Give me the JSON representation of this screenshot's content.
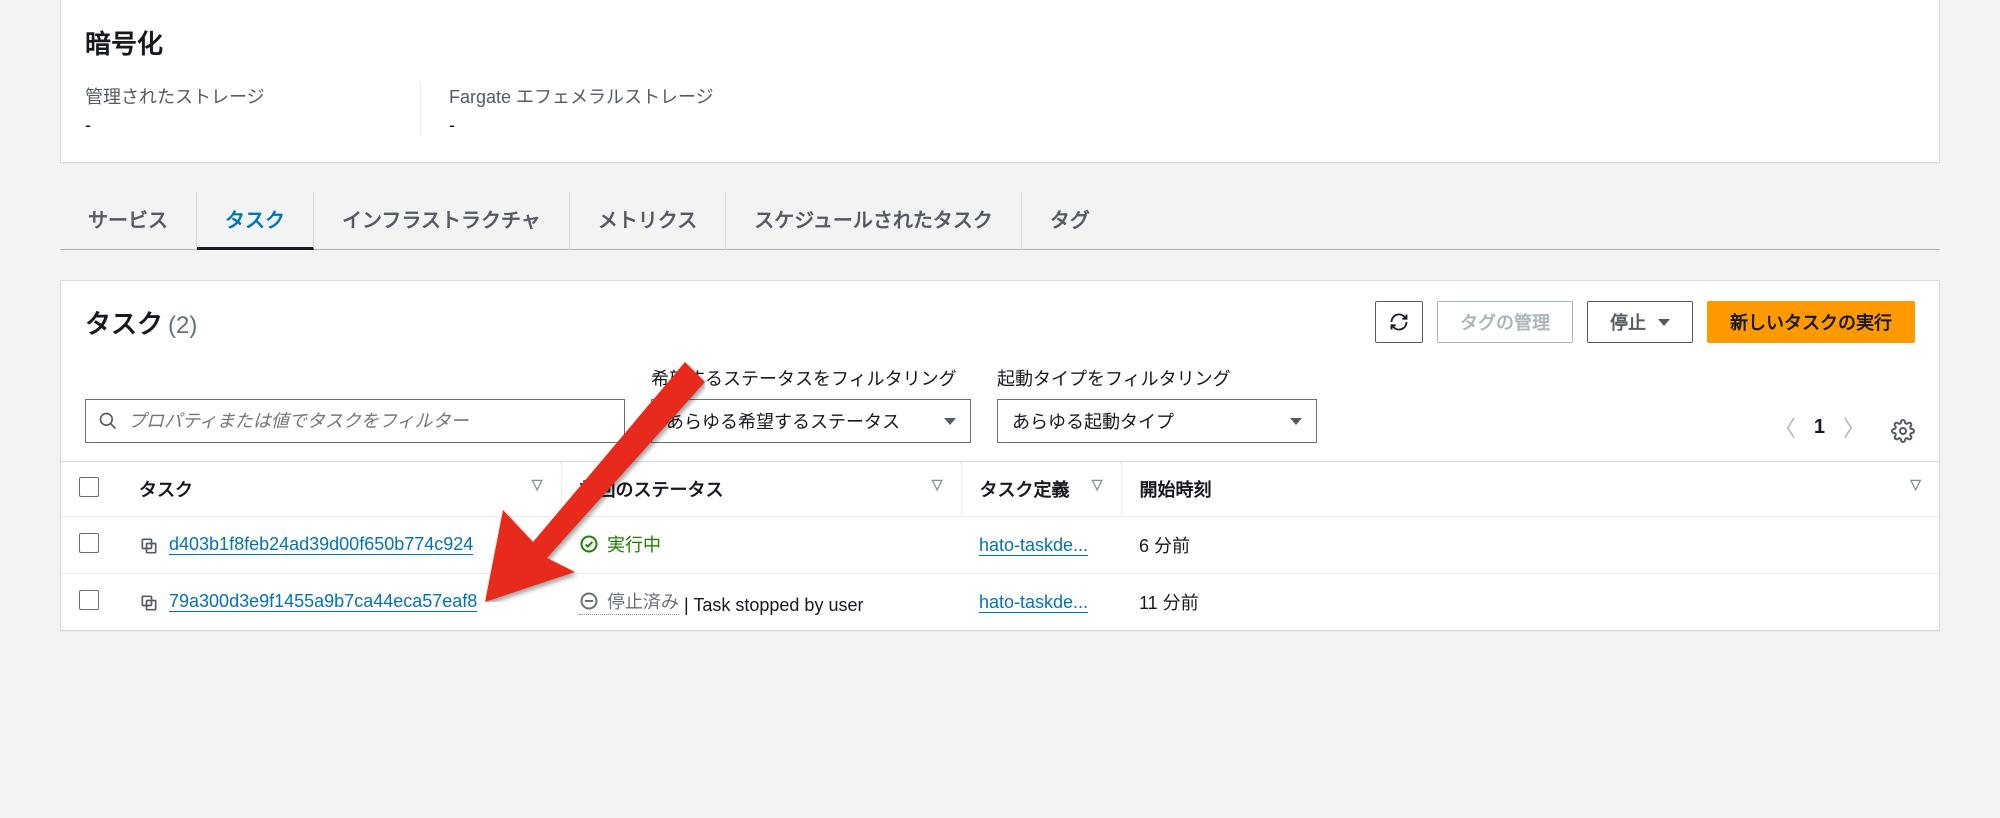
{
  "encryption_panel": {
    "title": "暗号化",
    "managed_storage_label": "管理されたストレージ",
    "managed_storage_value": "-",
    "fargate_label": "Fargate エフェメラルストレージ",
    "fargate_value": "-"
  },
  "tabs": {
    "services": "サービス",
    "tasks": "タスク",
    "infrastructure": "インフラストラクチャ",
    "metrics": "メトリクス",
    "scheduled": "スケジュールされたタスク",
    "tags": "タグ"
  },
  "tasks_panel": {
    "title": "タスク",
    "count": "(2)",
    "actions": {
      "manage_tags": "タグの管理",
      "stop": "停止",
      "run_new": "新しいタスクの実行"
    },
    "filters": {
      "search_placeholder": "プロパティまたは値でタスクをフィルター",
      "desired_status_label": "希望するステータスをフィルタリング",
      "desired_status_value": "あらゆる希望するステータス",
      "launch_type_label": "起動タイプをフィルタリング",
      "launch_type_value": "あらゆる起動タイプ"
    },
    "pagination": {
      "page": "1"
    },
    "columns": {
      "task": "タスク",
      "last_status": "前回のステータス",
      "task_definition": "タスク定義",
      "started": "開始時刻"
    },
    "rows": [
      {
        "task_id": "d403b1f8feb24ad39d00f650b774c924",
        "status_text": "実行中",
        "status_kind": "running",
        "status_reason": "",
        "task_definition": "hato-taskde...",
        "started": "6 分前"
      },
      {
        "task_id": "79a300d3e9f1455a9b7ca44eca57eaf8",
        "status_text": "停止済み",
        "status_kind": "stopped",
        "status_reason": "Task stopped by user",
        "task_definition": "hato-taskde...",
        "started": "11 分前"
      }
    ]
  }
}
